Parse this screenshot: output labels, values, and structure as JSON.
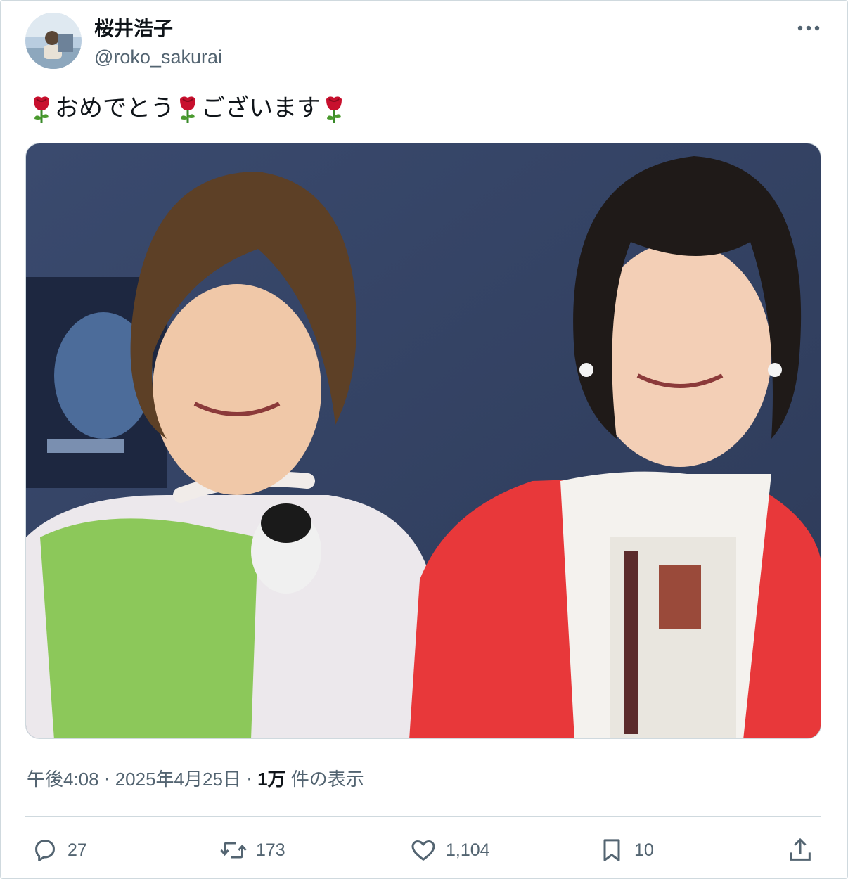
{
  "user": {
    "display_name": "桜井浩子",
    "handle": "@roko_sakurai"
  },
  "tweet": {
    "segments": [
      "おめでとう",
      "ございます"
    ],
    "emoji": "rose-icon"
  },
  "meta": {
    "time": "午後4:08",
    "separator": " · ",
    "date": "2025年4月25日",
    "views_count": "1万",
    "views_label": " 件の表示"
  },
  "actions": {
    "reply": "27",
    "retweet": "173",
    "like": "1,104",
    "bookmark": "10"
  },
  "colors": {
    "text": "#0f1419",
    "secondary": "#536471",
    "border": "#cfd9de",
    "rose": "#c8102e"
  }
}
